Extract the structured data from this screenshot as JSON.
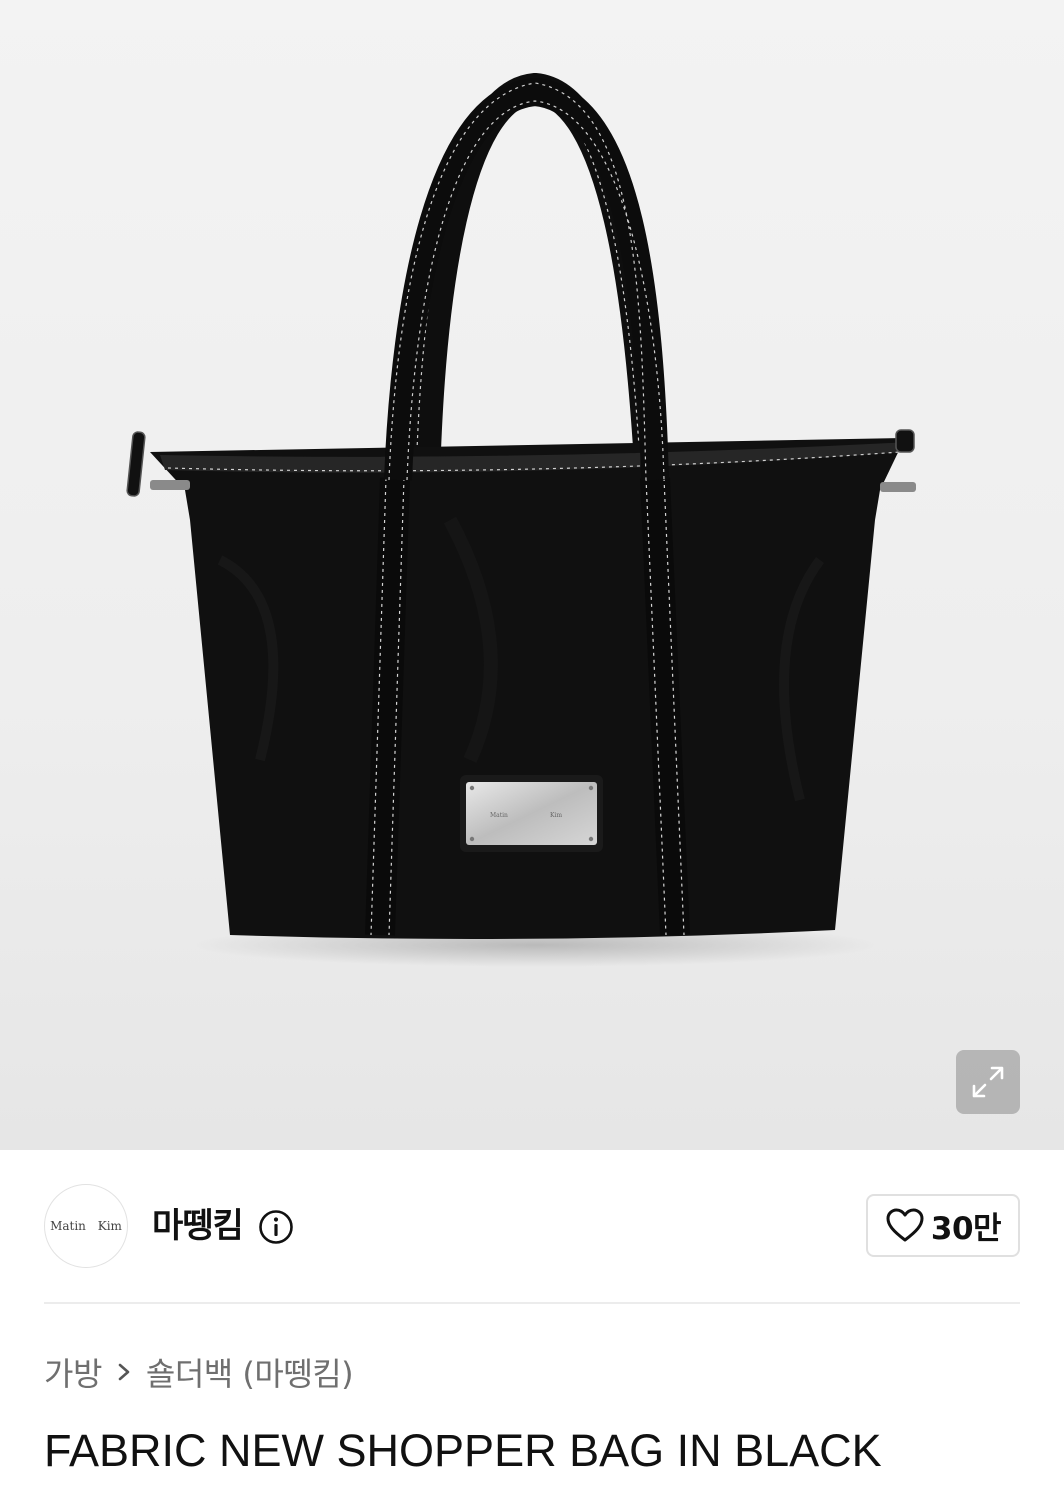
{
  "product_image": {
    "alt_icon": "product-photo",
    "bag_plate_text": [
      "Matin",
      "Kim"
    ]
  },
  "expand": {
    "icon": "expand-icon"
  },
  "brand": {
    "logo_text": "Matin Kim",
    "name": "마뗑킴",
    "info_icon": "info-icon"
  },
  "likes": {
    "icon": "heart-icon",
    "count": "30만"
  },
  "breadcrumb": {
    "items": [
      "가방",
      "숄더백 (마뗑킴)"
    ],
    "separator_icon": "chevron-right-icon"
  },
  "product": {
    "title": "FABRIC NEW SHOPPER BAG IN BLACK"
  },
  "colors": {
    "hero_bg": "#eeeeee",
    "bag": "#111111",
    "stitch": "#d9d9d9",
    "muted_text": "#6f6f6f"
  }
}
